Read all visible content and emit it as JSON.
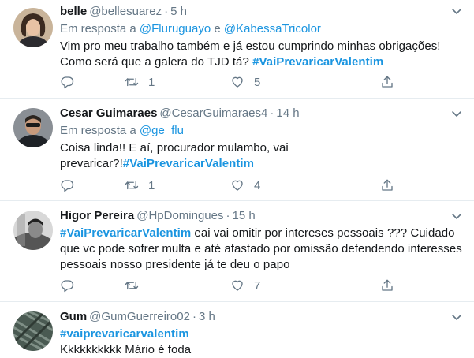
{
  "tweets": [
    {
      "name": "belle",
      "handle": "@bellesuarez",
      "time": "5 h",
      "reply_prefix": "Em resposta a",
      "reply_to_1": "@Fluruguayo",
      "reply_and": "e",
      "reply_to_2": "@KabessaTricolor",
      "text_1": "Vim pro meu trabalho também e já estou cumprindo minhas obrigações! Como será que a galera do TJD tá?",
      "hashtag": "#VaiPrevaricarValentim",
      "retweets": "1",
      "likes": "5"
    },
    {
      "name": "Cesar Guimaraes",
      "handle": "@CesarGuimaraes4",
      "time": "14 h",
      "reply_prefix": "Em resposta a",
      "reply_to_1": "@ge_flu",
      "text_1": "Coisa linda!! E aí, procurador mulambo, vai prevaricar?!",
      "hashtag": "#VaiPrevaricarValentim",
      "retweets": "1",
      "likes": "4"
    },
    {
      "name": "Higor Pereira",
      "handle": "@HpDomingues",
      "time": "15 h",
      "hashtag": "#VaiPrevaricarValentim",
      "text_after": " eai vai omitir por intereses pessoais ??? Cuidado que vc pode sofrer multa e até afastado por omissão defendendo interesses pessoais nosso presidente já te deu o papo",
      "likes": "7"
    },
    {
      "name": "Gum",
      "handle": "@GumGuerreiro02",
      "time": "3 h",
      "hashtag": "#vaiprevaricarvalentim",
      "text_after": "Kkkkkkkkkk Mário é foda"
    }
  ],
  "separator": "·",
  "colors": {
    "accent": "#1b95e0",
    "muted": "#657786",
    "text": "#14171a",
    "border": "#e6ecf0"
  },
  "icons": [
    "reply-icon",
    "retweet-icon",
    "like-icon",
    "share-icon",
    "chevron-down-icon"
  ]
}
